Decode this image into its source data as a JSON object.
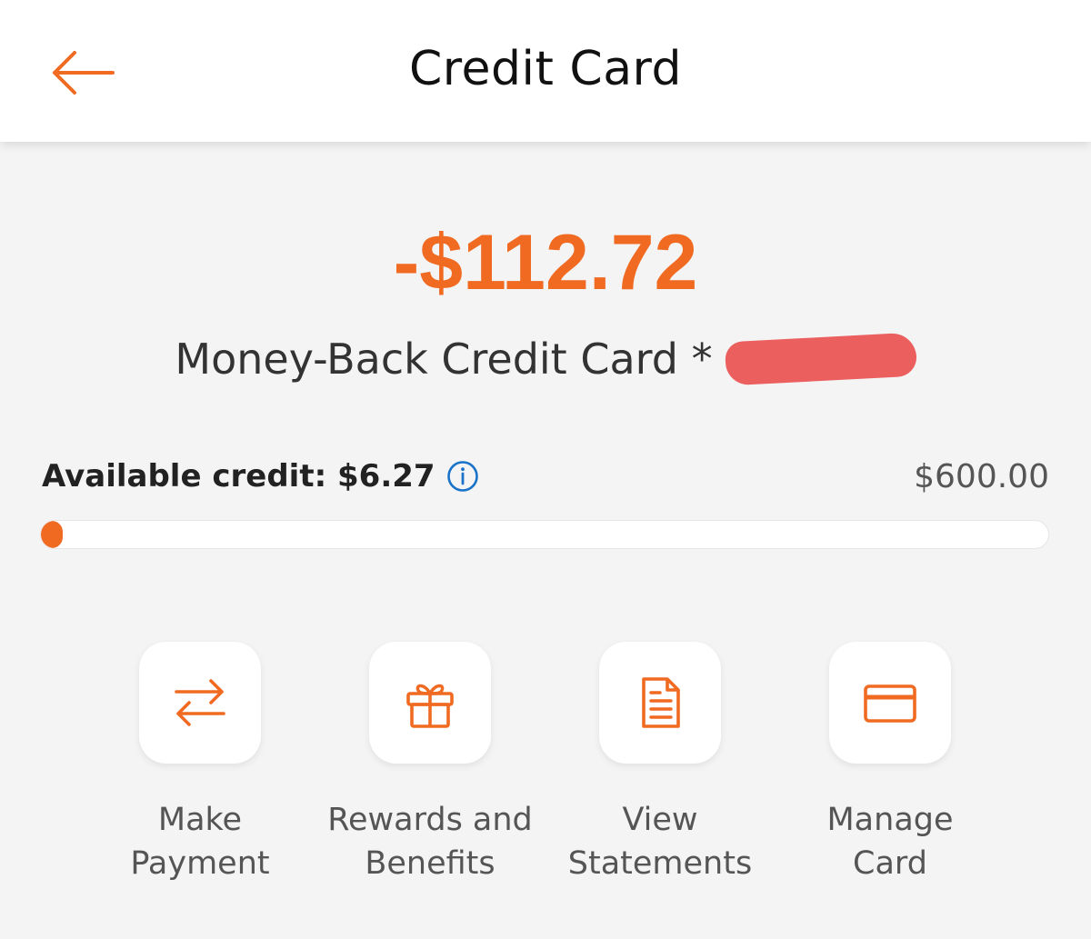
{
  "header": {
    "back_icon": "arrow-left-icon",
    "title": "Credit Card"
  },
  "balance": {
    "amount": "-$112.72",
    "card_name": "Money-Back Credit Card *"
  },
  "credit": {
    "available_label": "Available credit: $6.27",
    "info_icon": "info-icon",
    "limit": "$600.00",
    "used_fraction": 0.0105
  },
  "actions": [
    {
      "label": "Make\nPayment",
      "icon": "transfer-arrows-icon"
    },
    {
      "label": "Rewards and\nBenefits",
      "icon": "gift-icon"
    },
    {
      "label": "View\nStatements",
      "icon": "document-icon"
    },
    {
      "label": "Manage\nCard",
      "icon": "credit-card-icon"
    }
  ],
  "colors": {
    "accent": "#f06a22",
    "info": "#1a73c9",
    "background": "#f4f4f4",
    "redaction": "#ec5f5f"
  }
}
